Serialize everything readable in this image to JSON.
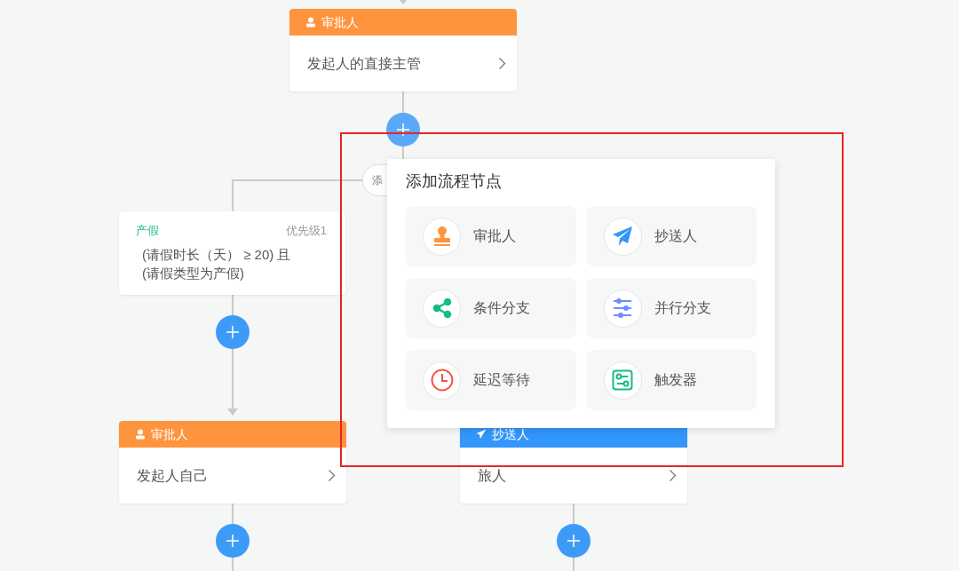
{
  "top_card": {
    "kind": "approver",
    "title": "审批人",
    "content": "发起人的直接主管"
  },
  "branch_pill": {
    "label": "添"
  },
  "condition_card": {
    "title": "产假",
    "priority": "优先级1",
    "condition_lines": [
      "(请假时长（天） ≥ 20) 且",
      "(请假类型为产假)"
    ]
  },
  "bottom_cards": [
    {
      "kind": "approver",
      "title": "审批人",
      "content": "发起人自己"
    },
    {
      "kind": "cc",
      "title": "抄送人",
      "content": "旅人"
    }
  ],
  "popover": {
    "title": "添加流程节点",
    "items": [
      {
        "kind": "approver",
        "label": "审批人"
      },
      {
        "kind": "cc",
        "label": "抄送人"
      },
      {
        "kind": "condition",
        "label": "条件分支"
      },
      {
        "kind": "parallel",
        "label": "并行分支"
      },
      {
        "kind": "delay",
        "label": "延迟等待"
      },
      {
        "kind": "trigger",
        "label": "触发器"
      }
    ]
  }
}
